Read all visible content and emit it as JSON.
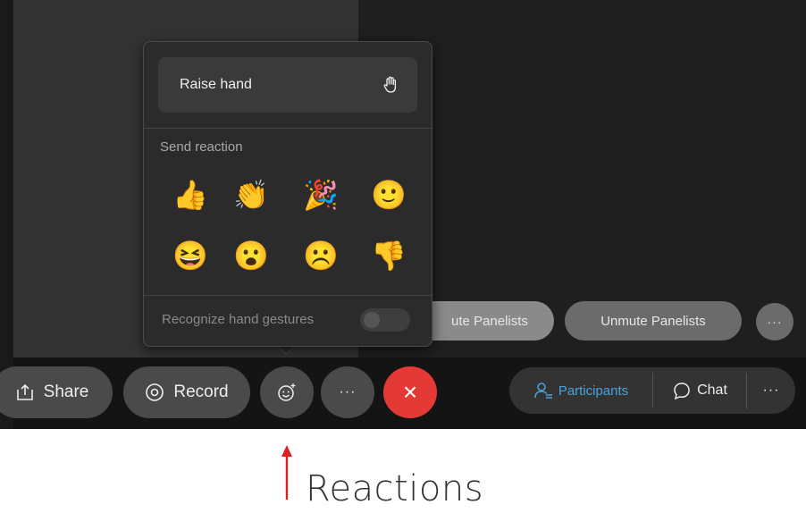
{
  "popup": {
    "raise_hand_label": "Raise hand",
    "send_reaction_label": "Send reaction",
    "reactions": [
      {
        "name": "thumbs-up",
        "glyph": "👍"
      },
      {
        "name": "clapping-hands",
        "glyph": "👏"
      },
      {
        "name": "party-popper",
        "glyph": "🎉"
      },
      {
        "name": "smiling-face",
        "glyph": "🙂"
      },
      {
        "name": "laughing-face",
        "glyph": "😆"
      },
      {
        "name": "surprised-face",
        "glyph": "😮"
      },
      {
        "name": "sad-face",
        "glyph": "☹️"
      },
      {
        "name": "thumbs-down",
        "glyph": "👎"
      }
    ],
    "gesture_label": "Recognize hand gestures",
    "gesture_enabled": false
  },
  "panelist_bar": {
    "mute_label": "ute Panelists",
    "unmute_label": "Unmute Panelists",
    "more_label": "···"
  },
  "controls": {
    "share_label": "Share",
    "record_label": "Record",
    "more_label": "···",
    "end_label": "×",
    "participants_label": "Participants",
    "chat_label": "Chat",
    "right_more_label": "···"
  },
  "annotation": {
    "label": "Reactions"
  },
  "colors": {
    "accent": "#4aa3df",
    "end_call": "#e53935",
    "annotation_arrow": "#e02020"
  }
}
